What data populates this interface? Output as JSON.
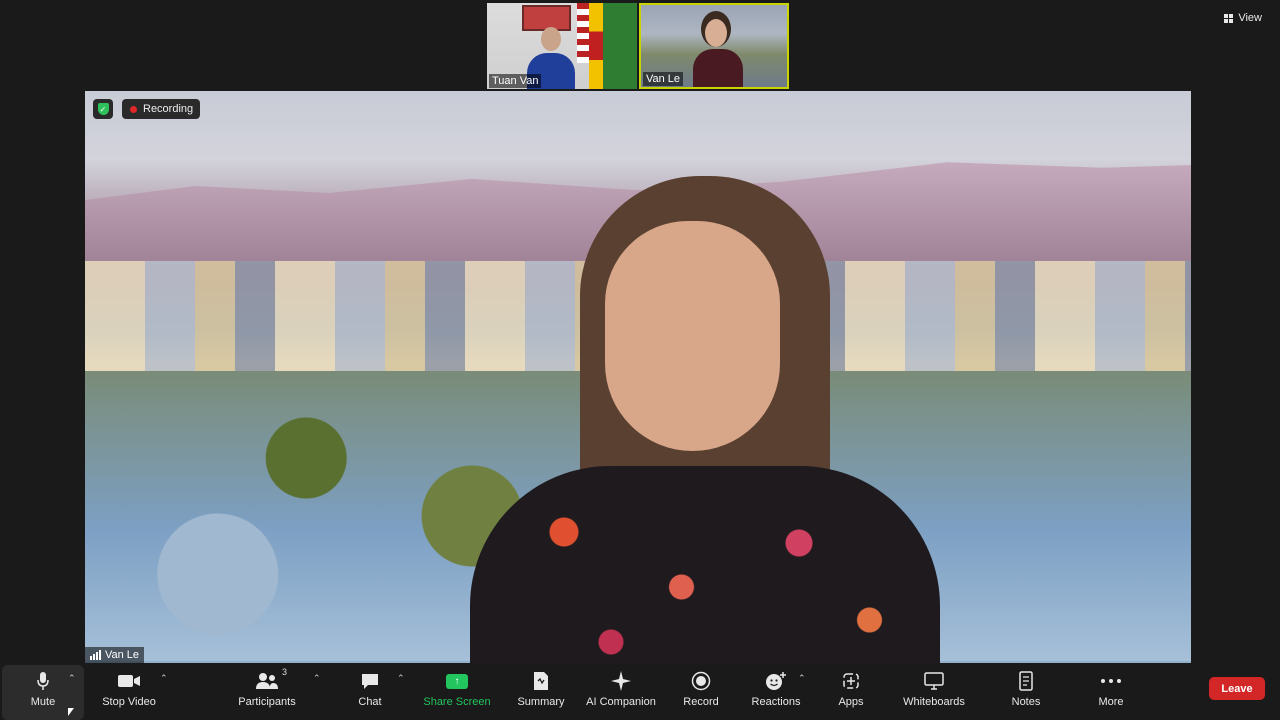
{
  "header": {
    "view_label": "View"
  },
  "thumbnails": [
    {
      "name": "Tuan Van"
    },
    {
      "name": "Van Le"
    }
  ],
  "main_video": {
    "recording_label": "Recording",
    "speaker_name": "Van Le"
  },
  "toolbar": {
    "mute": "Mute",
    "stop_video": "Stop Video",
    "participants": "Participants",
    "participants_count": "3",
    "chat": "Chat",
    "share_screen": "Share Screen",
    "summary": "Summary",
    "ai_companion": "AI Companion",
    "record": "Record",
    "reactions": "Reactions",
    "apps": "Apps",
    "whiteboards": "Whiteboards",
    "notes": "Notes",
    "more": "More",
    "leave": "Leave"
  },
  "colors": {
    "share_screen_accent": "#23c55e",
    "leave_button": "#d32626",
    "recording_dot": "#e02828",
    "active_speaker_border": "#c8d400"
  }
}
